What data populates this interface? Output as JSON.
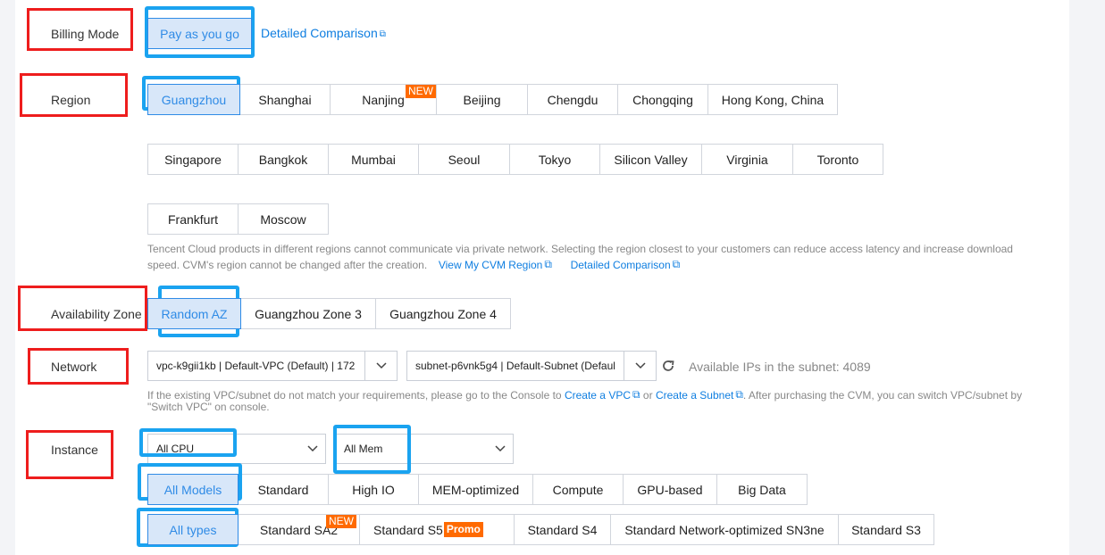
{
  "billing": {
    "label": "Billing Mode",
    "option": "Pay as you go",
    "comparison_link": "Detailed Comparison"
  },
  "region": {
    "label": "Region",
    "row1": [
      {
        "label": "Guangzhou",
        "selected": true
      },
      {
        "label": "Shanghai"
      },
      {
        "label": "Nanjing",
        "tag": "NEW"
      },
      {
        "label": "Beijing"
      },
      {
        "label": "Chengdu"
      },
      {
        "label": "Chongqing"
      },
      {
        "label": "Hong Kong, China"
      }
    ],
    "row2": [
      {
        "label": "Singapore"
      },
      {
        "label": "Bangkok"
      },
      {
        "label": "Mumbai"
      },
      {
        "label": "Seoul"
      },
      {
        "label": "Tokyo"
      },
      {
        "label": "Silicon Valley"
      },
      {
        "label": "Virginia"
      },
      {
        "label": "Toronto"
      }
    ],
    "row3": [
      {
        "label": "Frankfurt"
      },
      {
        "label": "Moscow"
      }
    ],
    "help_line1": "Tencent Cloud products in different regions cannot communicate via private network. Selecting the region closest to your customers can reduce access latency and increase download",
    "help_line2": "speed. CVM's region cannot be changed after the creation.",
    "view_region_link": "View My CVM Region",
    "comparison_link": "Detailed Comparison"
  },
  "zone": {
    "label": "Availability Zone",
    "options": [
      {
        "label": "Random AZ",
        "selected": true
      },
      {
        "label": "Guangzhou Zone 3"
      },
      {
        "label": "Guangzhou Zone 4"
      }
    ]
  },
  "network": {
    "label": "Network",
    "vpc": "vpc-k9gii1kb | Default-VPC (Default) | 172",
    "subnet": "subnet-p6vnk5g4 | Default-Subnet (Defaul",
    "available_ips": "Available IPs in the subnet: 4089",
    "help_prefix": "If the existing VPC/subnet do not match your requirements, please go to the Console to",
    "create_vpc": "Create a VPC",
    "or": "or",
    "create_subnet": "Create a Subnet",
    "help_suffix": ". After purchasing the CVM, you can switch VPC/subnet by",
    "help_line2": "\"Switch VPC\" on console."
  },
  "instance": {
    "label": "Instance",
    "cpu": "All CPU",
    "mem": "All Mem",
    "families": [
      {
        "label": "All Models",
        "selected": true
      },
      {
        "label": "Standard"
      },
      {
        "label": "High IO"
      },
      {
        "label": "MEM-optimized"
      },
      {
        "label": "Compute"
      },
      {
        "label": "GPU-based"
      },
      {
        "label": "Big Data"
      }
    ],
    "types": [
      {
        "label": "All types",
        "selected": true
      },
      {
        "label": "Standard SA2",
        "tag": "NEW"
      },
      {
        "label": "Standard S5",
        "tag": "Promo"
      },
      {
        "label": "Standard S4"
      },
      {
        "label": "Standard Network-optimized SN3ne"
      },
      {
        "label": "Standard S3"
      }
    ]
  },
  "colors": {
    "highlight_red": "#ee1d1d",
    "highlight_blue": "#1aa3f0",
    "selected_bg": "#d8e7f9",
    "accent": "#2f8be6",
    "tag_orange": "#ff6a00"
  }
}
